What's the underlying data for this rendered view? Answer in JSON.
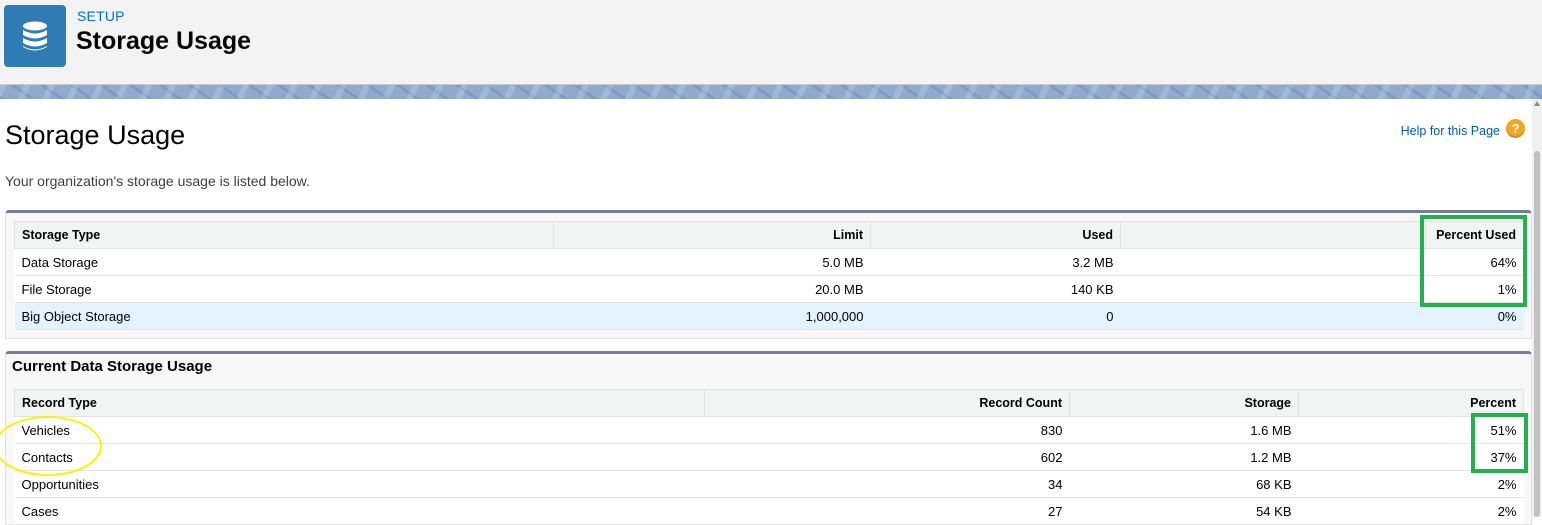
{
  "header": {
    "section": "SETUP",
    "title": "Storage Usage",
    "icon": "database-icon",
    "icon_color": "#2f7bb3"
  },
  "page": {
    "title": "Storage Usage",
    "subtitle": "Your organization's storage usage is listed below.",
    "help_link": "Help for this Page",
    "help_icon": "?"
  },
  "storage_table": {
    "headers": [
      "Storage Type",
      "Limit",
      "Used",
      "",
      "Percent Used"
    ],
    "rows": [
      {
        "type": "Data Storage",
        "limit": "5.0 MB",
        "used": "3.2 MB",
        "percent": "64%"
      },
      {
        "type": "File Storage",
        "limit": "20.0 MB",
        "used": "140 KB",
        "percent": "1%"
      },
      {
        "type": "Big Object Storage",
        "limit": "1,000,000",
        "used": "0",
        "percent": "0%"
      }
    ]
  },
  "data_storage": {
    "title": "Current Data Storage Usage",
    "headers": [
      "Record Type",
      "Record Count",
      "Storage",
      "Percent"
    ],
    "rows": [
      {
        "type": "Vehicles",
        "count": "830",
        "storage": "1.6 MB",
        "percent": "51%"
      },
      {
        "type": "Contacts",
        "count": "602",
        "storage": "1.2 MB",
        "percent": "37%"
      },
      {
        "type": "Opportunities",
        "count": "34",
        "storage": "68 KB",
        "percent": "2%"
      },
      {
        "type": "Cases",
        "count": "27",
        "storage": "54 KB",
        "percent": "2%"
      }
    ]
  },
  "annotations": {
    "highlight_color": "#22b14c",
    "circle_color": "#fff200"
  }
}
